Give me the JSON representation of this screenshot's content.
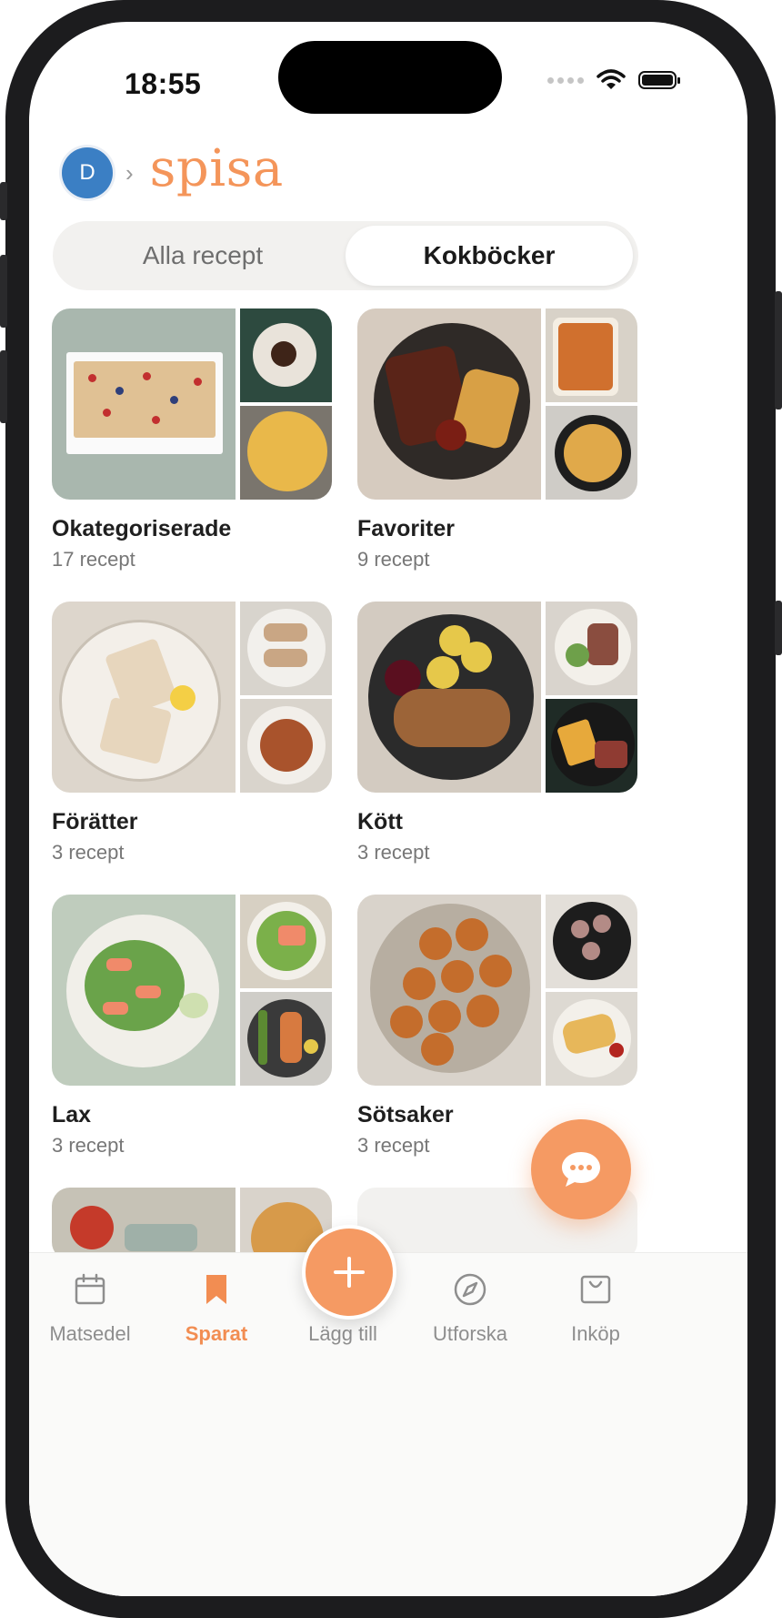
{
  "status_bar": {
    "time": "18:55"
  },
  "header": {
    "avatar_initial": "D",
    "logo": "spisa"
  },
  "segment": {
    "all_label": "Alla recept",
    "books_label": "Kokböcker",
    "selected": "Kokböcker"
  },
  "cookbooks": [
    {
      "title": "Okategoriserade",
      "count": "17 recept"
    },
    {
      "title": "Favoriter",
      "count": "9 recept"
    },
    {
      "title": "Förätter",
      "count": "3 recept"
    },
    {
      "title": "Kött",
      "count": "3 recept"
    },
    {
      "title": "Lax",
      "count": "3 recept"
    },
    {
      "title": "Sötsaker",
      "count": "3 recept"
    }
  ],
  "tabbar": {
    "items": [
      {
        "label": "Matsedel",
        "icon": "calendar-icon"
      },
      {
        "label": "Sparat",
        "icon": "bookmark-icon",
        "active": true
      },
      {
        "label": "Lägg till",
        "icon": "plus-icon"
      },
      {
        "label": "Utforska",
        "icon": "compass-icon"
      },
      {
        "label": "Inköp",
        "icon": "shopping-bag-icon"
      }
    ]
  },
  "colors": {
    "accent": "#f59a63",
    "logo": "#f4955a",
    "avatar": "#3b7fc4"
  }
}
